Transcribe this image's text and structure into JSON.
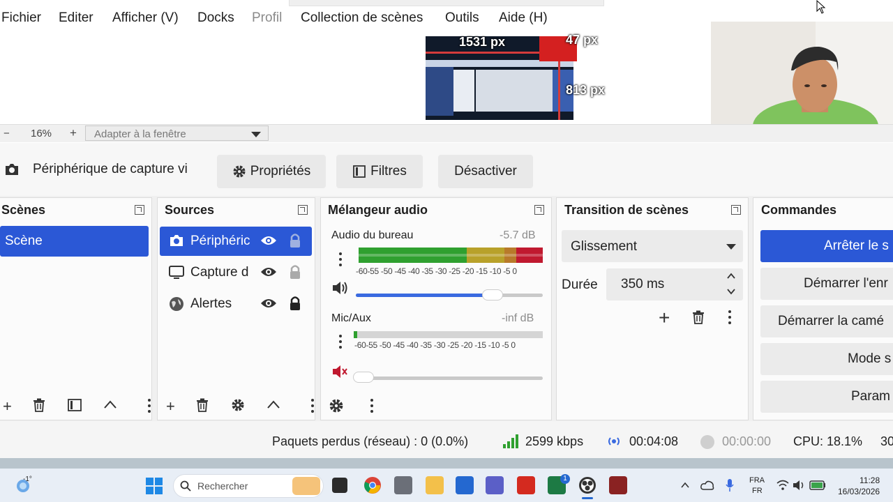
{
  "menu": {
    "items": [
      "Fichier",
      "Editer",
      "Afficher (V)",
      "Docks",
      "Profil",
      "Collection de scènes",
      "Outils",
      "Aide (H)"
    ]
  },
  "preview": {
    "width_label": "1531 px",
    "right_label": "47 px",
    "height_label": "813 px"
  },
  "zoom": {
    "minus": "−",
    "value": "16%",
    "plus": "+",
    "mode": "Adapter à la fenêtre"
  },
  "source_toolbar": {
    "source_name": "Périphérique de capture vi",
    "properties": "Propriétés",
    "filters": "Filtres",
    "deactivate": "Désactiver"
  },
  "scenes": {
    "title": "Scènes",
    "items": [
      "Scène"
    ]
  },
  "sources": {
    "title": "Sources",
    "items": [
      "Périphéric",
      "Capture d",
      "Alertes"
    ]
  },
  "mixer": {
    "title": "Mélangeur audio",
    "channels": [
      {
        "name": "Audio du bureau",
        "db": "-5.7 dB",
        "volume": 0.82,
        "muted": false
      },
      {
        "name": "Mic/Aux",
        "db": "-inf dB",
        "volume": 0.05,
        "muted": true
      }
    ],
    "scale": "-60-55 -50 -45 -40 -35 -30 -25 -20 -15 -10  -5   0"
  },
  "transition": {
    "title": "Transition de scènes",
    "type": "Glissement",
    "duration_label": "Durée",
    "duration": "350 ms"
  },
  "commands": {
    "title": "Commandes",
    "buttons": [
      "Arrêter le s",
      "Démarrer l'enr",
      "Démarrer la camé",
      "Mode s",
      "Param"
    ]
  },
  "status": {
    "dropped": "Paquets perdus (réseau) : 0 (0.0%)",
    "bitrate": "2599 kbps",
    "stream_time": "00:04:08",
    "rec_time": "00:00:00",
    "cpu": "CPU: 18.1%",
    "fps": "30"
  },
  "taskbar": {
    "weather": "-1°",
    "search": "Rechercher",
    "lang1": "FRA",
    "lang2": "FR",
    "time": "11:28",
    "date": "16/03/2026",
    "badge": "1"
  },
  "colors": {
    "accent": "#2b58d6",
    "meter_green": "#2fa02f",
    "meter_yellow": "#b8a12a",
    "meter_red": "#c0192f"
  }
}
